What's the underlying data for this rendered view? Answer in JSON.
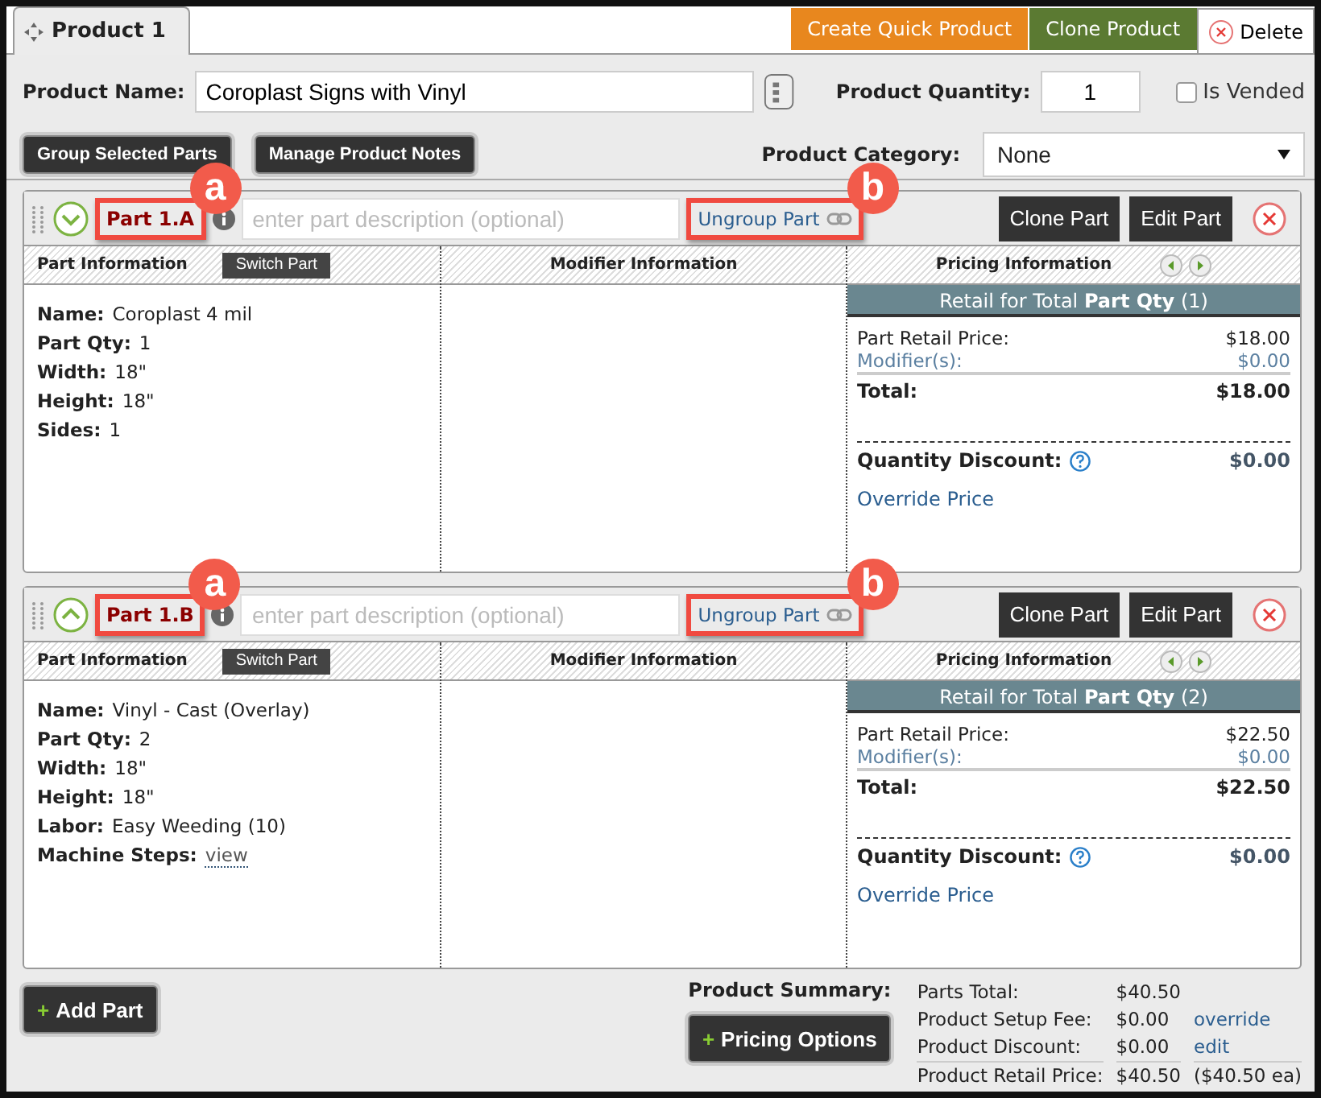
{
  "tab": {
    "label": "Product 1"
  },
  "header_buttons": [
    {
      "label": "Create Quick Product",
      "kind": "orange"
    },
    {
      "label": "Clone Product",
      "kind": "green"
    }
  ],
  "delete": {
    "label": "Delete"
  },
  "product_name": {
    "label": "Product Name:",
    "value": "Coroplast Signs with Vinyl"
  },
  "quantity": {
    "label": "Product Quantity:",
    "value": "1"
  },
  "is_vended": {
    "label": "Is Vended",
    "checked": false
  },
  "toolbar_buttons": [
    "Group Selected Parts",
    "Manage Product Notes"
  ],
  "category": {
    "label": "Product Category:",
    "value": "None"
  },
  "parts": [
    {
      "label": "Part 1.A",
      "expanded": false,
      "label_callout": "a",
      "description_placeholder": "enter part description (optional)",
      "ungroup": {
        "label": "Ungroup Part",
        "callout": "b"
      },
      "buttons": [
        "Clone Part",
        "Edit Part"
      ],
      "columns": [
        "Part Information",
        "Modifier Information",
        "Pricing Information"
      ],
      "switch_button": "Switch Part",
      "info": [
        {
          "label": "Name:",
          "value": "Coroplast 4 mil"
        },
        {
          "label": "Part Qty:",
          "value": "1"
        },
        {
          "label": "Width:",
          "value": "18\""
        },
        {
          "label": "Height:",
          "value": "18\""
        },
        {
          "label": "Sides:",
          "value": "1"
        }
      ],
      "pricing": {
        "banner": "Retail for Total **Part Qty** (1)",
        "rows": [
          {
            "label": "Part Retail Price:",
            "value": "$18.00",
            "kind": "plain"
          },
          {
            "label": "Modifier(s):",
            "value": "$0.00",
            "kind": "link"
          }
        ],
        "total": {
          "label": "Total:",
          "value": "$18.00"
        },
        "discount": {
          "label": "Quantity Discount:",
          "value": "$0.00"
        },
        "override": "Override Price"
      }
    },
    {
      "label": "Part 1.B",
      "expanded": true,
      "label_callout": "a",
      "description_placeholder": "enter part description (optional)",
      "ungroup": {
        "label": "Ungroup Part",
        "callout": "b"
      },
      "buttons": [
        "Clone Part",
        "Edit Part"
      ],
      "columns": [
        "Part Information",
        "Modifier Information",
        "Pricing Information"
      ],
      "switch_button": "Switch Part",
      "info": [
        {
          "label": "Name:",
          "value": "Vinyl - Cast (Overlay)"
        },
        {
          "label": "Part Qty:",
          "value": "2"
        },
        {
          "label": "Width:",
          "value": "18\""
        },
        {
          "label": "Height:",
          "value": "18\""
        },
        {
          "label": "Labor:",
          "value": "Easy Weeding (10)"
        },
        {
          "label": "Machine Steps:",
          "link": "view"
        }
      ],
      "pricing": {
        "banner": "Retail for Total **Part Qty** (2)",
        "rows": [
          {
            "label": "Part Retail Price:",
            "value": "$22.50",
            "kind": "plain"
          },
          {
            "label": "Modifier(s):",
            "value": "$0.00",
            "kind": "link"
          }
        ],
        "total": {
          "label": "Total:",
          "value": "$22.50"
        },
        "discount": {
          "label": "Quantity Discount:",
          "value": "$0.00"
        },
        "override": "Override Price"
      }
    }
  ],
  "add_part": {
    "icon": "+",
    "label": "Add Part"
  },
  "summary": {
    "label": "Product Summary:",
    "pricing_button": {
      "icon": "+",
      "label": "Pricing Options"
    },
    "rows": [
      {
        "label": "Parts Total:",
        "value": "$40.50"
      },
      {
        "label": "Product Setup Fee:",
        "value": "$0.00",
        "action": "override"
      },
      {
        "label": "Product Discount:",
        "value": "$0.00",
        "action": "edit"
      },
      {
        "label": "Product Retail Price:",
        "value": "$40.50",
        "note": "($40.50 ea)"
      }
    ]
  }
}
